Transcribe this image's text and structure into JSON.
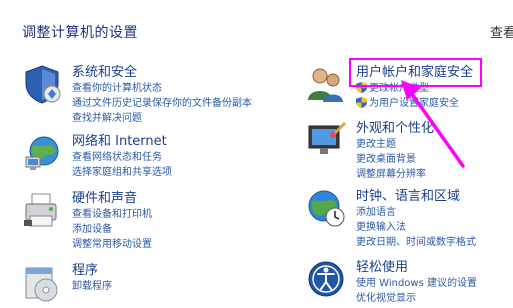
{
  "header": {
    "title": "调整计算机的设置",
    "view_by": "查看"
  },
  "categories": [
    {
      "id": "system-security",
      "title": "系统和安全",
      "icon": "shield-flag-icon",
      "links": [
        "查看你的计算机状态",
        "通过文件历史记录保存你的文件备份副本",
        "查找并解决问题"
      ]
    },
    {
      "id": "network-internet",
      "title": "网络和 Internet",
      "icon": "network-globe-icon",
      "links": [
        "查看网络状态和任务",
        "选择家庭组和共享选项"
      ]
    },
    {
      "id": "hardware-sound",
      "title": "硬件和声音",
      "icon": "printer-icon",
      "links": [
        "查看设备和打印机",
        "添加设备",
        "调整常用移动设置"
      ]
    },
    {
      "id": "programs",
      "title": "程序",
      "icon": "programs-disc-icon",
      "links": [
        "卸载程序"
      ]
    },
    {
      "id": "user-accounts",
      "title": "用户帐户和家庭安全",
      "icon": "users-icon",
      "links": [
        "更改帐户类型",
        "为用户设置家庭安全"
      ]
    },
    {
      "id": "appearance",
      "title": "外观和个性化",
      "icon": "monitor-brush-icon",
      "links": [
        "更改主题",
        "更改桌面背景",
        "调整屏幕分辨率"
      ]
    },
    {
      "id": "clock-region",
      "title": "时钟、语言和区域",
      "icon": "globe-clock-icon",
      "links": [
        "添加语言",
        "更换输入法",
        "更改日期、时间或数字格式"
      ]
    },
    {
      "id": "ease-of-access",
      "title": "轻松使用",
      "icon": "ease-access-icon",
      "links": [
        "使用 Windows 建议的设置",
        "优化视觉显示"
      ]
    }
  ],
  "annotation": {
    "highlight_color": "#ff00ff"
  }
}
